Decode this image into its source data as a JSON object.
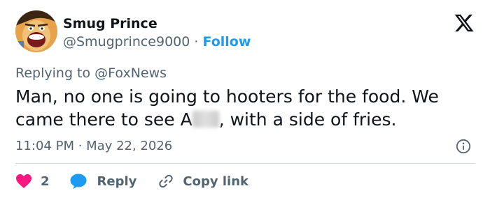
{
  "author": {
    "name": "Smug Prince",
    "handle": "@Smugprince9000",
    "separator": "·",
    "follow_label": "Follow"
  },
  "reply_context": {
    "prefix": "Replying to ",
    "mention": "@FoxNews"
  },
  "tweet": {
    "line1": "Man, no one is going to hooters for the food. We",
    "line2_before": "came there to see A",
    "line2_after": ", with a side of fries."
  },
  "timestamp": {
    "time": "11:04 PM",
    "separator": " · ",
    "date": "May 22, 2026"
  },
  "actions": {
    "like_count": "2",
    "reply_label": "Reply",
    "copy_label": "Copy link"
  },
  "icons": {
    "brand": "x-logo-icon",
    "info": "info-icon",
    "like": "heart-icon",
    "reply": "speech-bubble-icon",
    "copy": "link-icon"
  },
  "colors": {
    "text": "#0f1419",
    "secondary": "#536471",
    "accent": "#1d9bf0",
    "like": "#f91880",
    "divider": "#cfd9de"
  }
}
